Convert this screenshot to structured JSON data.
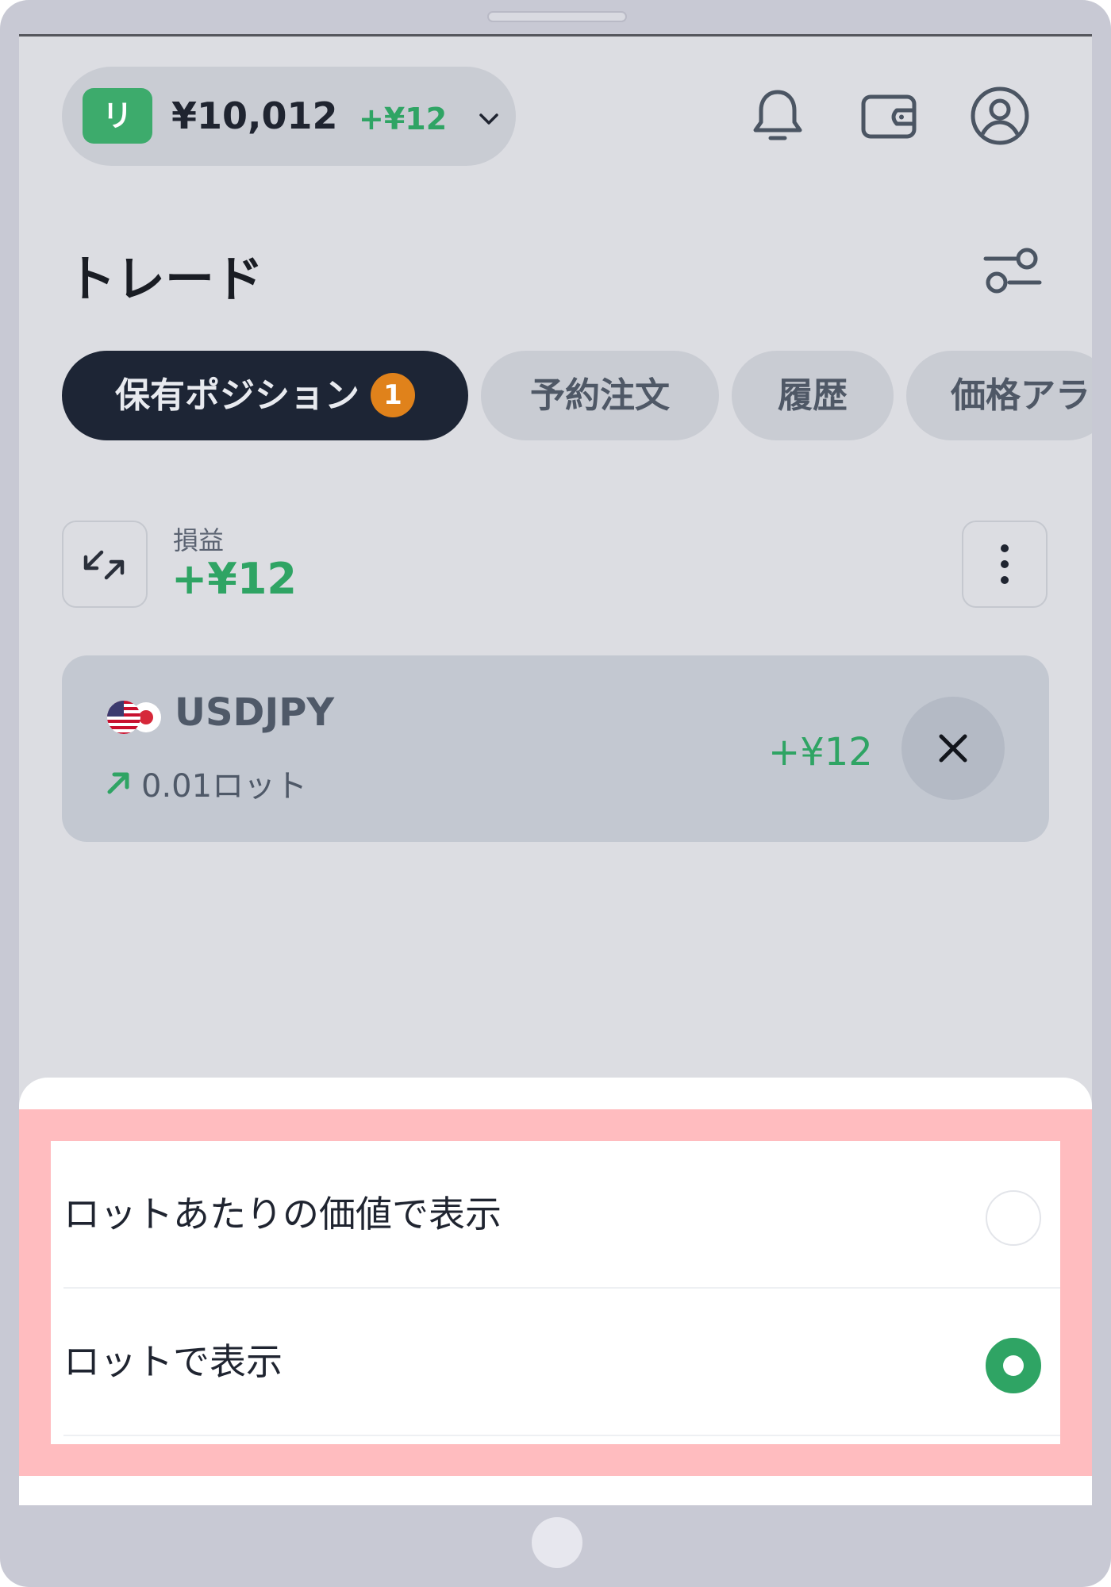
{
  "header": {
    "account_badge": "リ",
    "balance": "¥10,012",
    "balance_change": "+¥12",
    "icons": [
      "chevron-down-icon",
      "bell-icon",
      "wallet-icon",
      "user-icon"
    ]
  },
  "page": {
    "title": "トレード",
    "filter_icon": "sliders-icon"
  },
  "tabs": [
    {
      "label": "保有ポジション",
      "count": "1",
      "active": true
    },
    {
      "label": "予約注文",
      "active": false
    },
    {
      "label": "履歴",
      "active": false
    },
    {
      "label": "価格アラ",
      "active": false
    }
  ],
  "pnl": {
    "label": "損益",
    "value": "+¥12",
    "switch_icon": "swap-arrows-icon",
    "menu_icon": "more-vertical-icon"
  },
  "positions": [
    {
      "symbol": "USDJPY",
      "lot": "0.01ロット",
      "direction": "buy",
      "pnl": "+¥12"
    }
  ],
  "sheet": {
    "options": [
      {
        "label": "ロットあたりの価値で表示",
        "selected": false
      },
      {
        "label": "ロットで表示",
        "selected": true
      }
    ]
  },
  "colors": {
    "accent_green": "#2fa464",
    "badge_orange": "#e0821b",
    "dark_tab": "#1d2535",
    "highlight": "#ffbcbf"
  }
}
